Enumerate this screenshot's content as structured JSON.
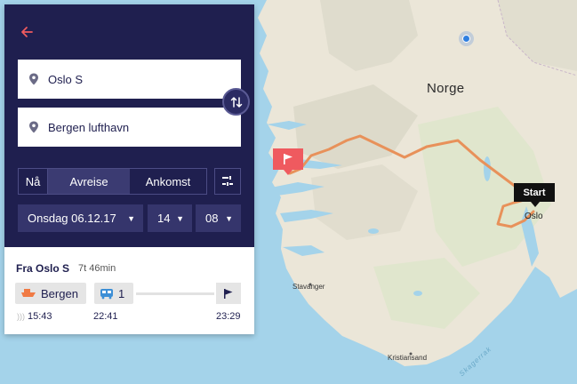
{
  "map": {
    "country_label": "Norge",
    "city_labels": {
      "oslo": "Oslo",
      "stavanger": "Stavanger",
      "kristiansand": "Kristiansand"
    },
    "sea_label": "Skagerrak",
    "start_label": "Start",
    "colors": {
      "water": "#a4d3ea",
      "land": "#ebe6d8",
      "route": "#e8915a",
      "marker": "#ef5a5f"
    }
  },
  "search": {
    "back_icon": "arrow-left-icon",
    "from": "Oslo S",
    "to": "Bergen lufthavn",
    "swap_icon": "swap-vertical-icon",
    "time_mode": {
      "now": "Nå",
      "departure": "Avreise",
      "arrival": "Ankomst",
      "selected": "Avreise"
    },
    "filter_icon": "filter-icon",
    "date": "Onsdag 06.12.17",
    "hour": "14",
    "minute": "08"
  },
  "result": {
    "title": "Fra Oslo S",
    "duration": "7t 46min",
    "legs": [
      {
        "icon": "boat-icon",
        "label": "Bergen",
        "time": "15:43"
      },
      {
        "icon": "bus-icon",
        "label": "1",
        "time": "22:41"
      },
      {
        "icon": "flag-icon",
        "label": "",
        "time": "23:29"
      }
    ]
  },
  "colors": {
    "panel_bg": "#1f1f4f",
    "accent": "#ef5a5f"
  }
}
